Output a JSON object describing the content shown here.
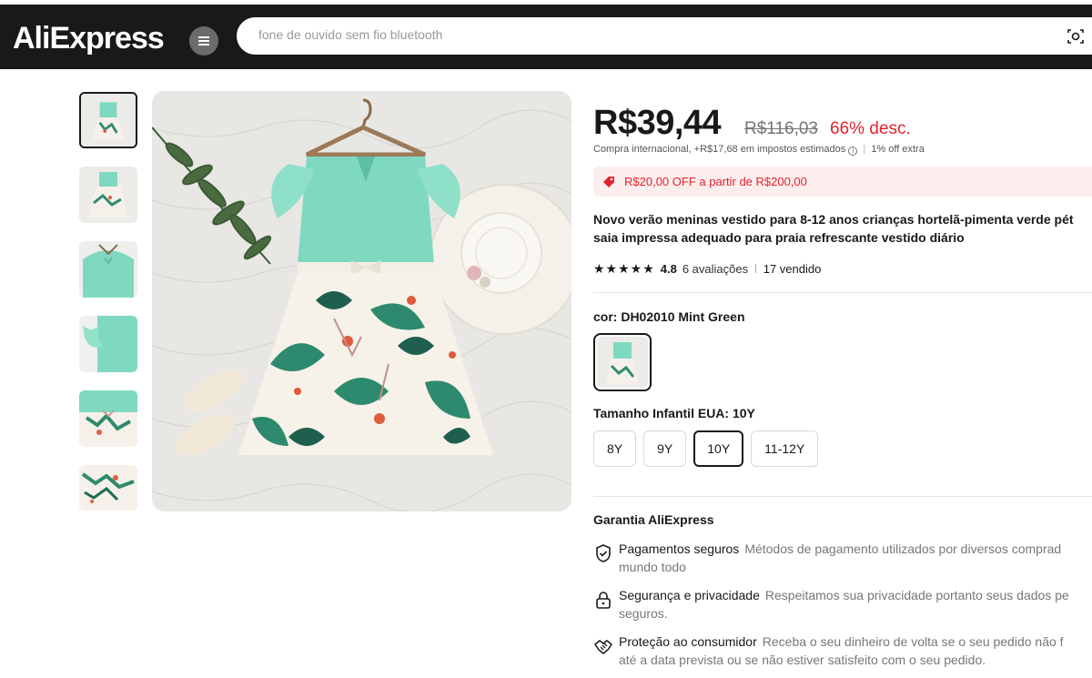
{
  "header": {
    "logo": "AliExpress",
    "search_placeholder": "fone de ouvido sem fio bluetooth"
  },
  "product": {
    "price": "R$39,44",
    "original_price": "R$116,03",
    "discount": "66% desc.",
    "tax_note": "Compra internacional, +R$17,68 em impostos estimados",
    "extra_off": "1% off extra",
    "coupon": "R$20,00 OFF a partir de R$200,00",
    "title_line1": "Novo verão meninas vestido para 8-12 anos crianças hortelã-pimenta verde pét",
    "title_line2": "saia impressa adequado para praia refrescante vestido diário",
    "stars": "★★★★★",
    "rating": "4.8",
    "reviews": "6 avaliações",
    "sold": "17 vendido",
    "color_label": "cor: DH02010 Mint Green",
    "size_label": "Tamanho Infantil EUA: 10Y",
    "sizes": [
      "8Y",
      "9Y",
      "10Y",
      "11-12Y"
    ],
    "selected_size": "10Y"
  },
  "guarantee": {
    "title": "Garantia AliExpress",
    "items": [
      {
        "name": "Pagamentos seguros",
        "line1": "Métodos de pagamento utilizados por diversos comprad",
        "line2": "mundo todo",
        "icon": "shield-check-icon"
      },
      {
        "name": "Segurança e privacidade",
        "line1": "Respeitamos sua privacidade portanto seus dados pe",
        "line2": "seguros.",
        "icon": "lock-icon"
      },
      {
        "name": "Proteção ao consumidor",
        "line1": "Receba o seu dinheiro de volta se o seu pedido não f",
        "line2": "até a data prevista ou se não estiver satisfeito com o seu pedido.",
        "icon": "handshake-icon"
      }
    ]
  },
  "colors": {
    "header_bg": "#191919",
    "price_red": "#e2222c",
    "mint": "#7fd9c0",
    "coupon_bg": "#fdeeee"
  }
}
